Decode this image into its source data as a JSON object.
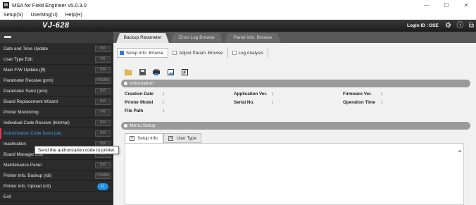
{
  "window": {
    "title": "MSA for Field Engineer v5.0.3.0",
    "icon": "app-logo-icon"
  },
  "menubar": {
    "items": [
      {
        "label": "Setup(S)"
      },
      {
        "label": "UserMng(U)"
      },
      {
        "label": "Help(H)"
      }
    ]
  },
  "header": {
    "model": "VJ-628",
    "login_label": "Login ID :",
    "login_value": "OSE"
  },
  "sidebar": {
    "items": [
      {
        "label": "Date and Time Update",
        "badge": "BM"
      },
      {
        "label": "User Type Edit",
        "badge": "PR"
      },
      {
        "label": "Main F/W Update (jfl)",
        "badge": "BM"
      },
      {
        "label": "Parameter Receive (prm)",
        "badge": "PR&BM"
      },
      {
        "label": "Parameter Send (prm)",
        "badge": "BM"
      },
      {
        "label": "Board Replacement Wizard",
        "badge": "BM"
      },
      {
        "label": "Printer Monitoring",
        "badge": "PR"
      },
      {
        "label": "Individual Code Receive (lnk/mpi)",
        "badge": "BM"
      },
      {
        "label": "Authorization Code Send (uk)",
        "badge": "BM"
      },
      {
        "label": "Inactivation",
        "badge": "BM"
      },
      {
        "label": "Board Manager Edit",
        "badge": "BM"
      },
      {
        "label": "Maintenance Panel",
        "badge": "BM"
      },
      {
        "label": "Printer Info. Backup (rdi)",
        "badge": "PR&BM"
      },
      {
        "label": "Printer Info. Upload (rdi)",
        "bubble": "11"
      },
      {
        "label": "Exit"
      }
    ],
    "active_index": 8
  },
  "tooltip": {
    "text": "Send the authorization code to printer."
  },
  "tabs": [
    {
      "label": "Backup Parameter"
    },
    {
      "label": "Error Log Browse"
    },
    {
      "label": "Panel Info. Browse"
    }
  ],
  "subtabs": [
    {
      "label": "Setup Info. Browse"
    },
    {
      "label": "Adjust Param. Browse"
    },
    {
      "label": "Log Analysis"
    }
  ],
  "toolbar": {
    "icons": [
      "folder-icon",
      "save-icon",
      "printer-icon",
      "image-icon",
      "file-f-icon"
    ]
  },
  "information": {
    "title": "Information",
    "fields": [
      {
        "label": "Creation Date",
        "value": ""
      },
      {
        "label": "Printer Model",
        "value": ""
      },
      {
        "label": "File Path",
        "value": ""
      },
      {
        "label": "Application Ver.",
        "value": ""
      },
      {
        "label": "Serial No.",
        "value": ""
      },
      {
        "label": "Firmware Ver.",
        "value": ""
      },
      {
        "label": "Operation Time",
        "value": ""
      }
    ]
  },
  "menu_setup": {
    "title": "Menu Setup",
    "tabs": [
      {
        "label": "Setup Info."
      },
      {
        "label": "User Type"
      }
    ]
  },
  "colors": {
    "accent_blue": "#3aa2ea",
    "active_marker": "#e03a5a",
    "header_bg": "#1c1c1c"
  }
}
